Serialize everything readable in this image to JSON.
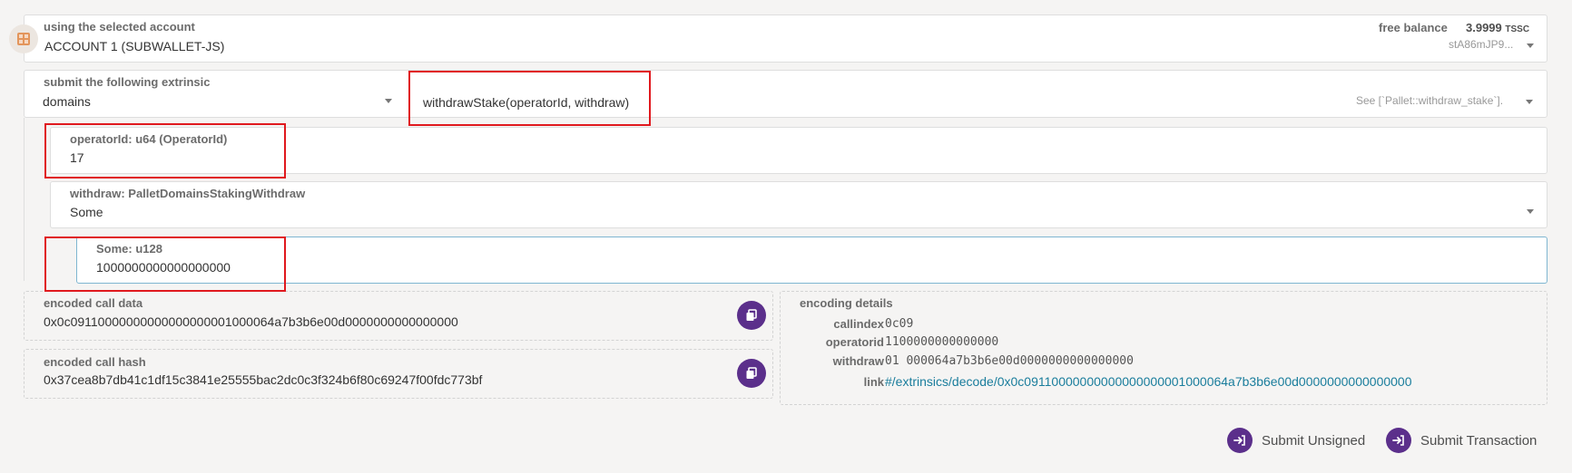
{
  "account": {
    "label": "using the selected account",
    "name": "ACCOUNT 1 (SUBWALLET-JS)",
    "balance_label": "free balance",
    "balance_value": "3.9999",
    "balance_unit": "TSSC",
    "address": "stA86mJP9..."
  },
  "extrinsic": {
    "label": "submit the following extrinsic",
    "pallet": "domains",
    "method": "withdrawStake(operatorId, withdraw)",
    "doc_hint": "See [`Pallet::withdraw_stake`]."
  },
  "params": {
    "operator_label": "operatorId: u64 (OperatorId)",
    "operator_value": "17",
    "withdraw_label": "withdraw: PalletDomainsStakingWithdraw",
    "withdraw_value": "Some",
    "some_label": "Some: u128",
    "some_value": "1000000000000000000"
  },
  "encoded": {
    "call_data_label": "encoded call data",
    "call_data": "0x0c09110000000000000000001000064a7b3b6e00d0000000000000000",
    "call_hash_label": "encoded call hash",
    "call_hash": "0x37cea8b7db41c1df15c3841e25555bac2dc0c3f324b6f80c69247f00fdc773bf"
  },
  "encoding_details": {
    "title": "encoding details",
    "rows": [
      {
        "key": "callindex",
        "value": "0c09"
      },
      {
        "key": "operatorid",
        "value": "1100000000000000"
      },
      {
        "key": "withdraw",
        "value": "01 000064a7b3b6e00d0000000000000000"
      },
      {
        "key": "link",
        "value": "#/extrinsics/decode/0x0c09110000000000000000001000064a7b3b6e00d0000000000000000"
      }
    ]
  },
  "actions": {
    "submit_unsigned": "Submit Unsigned",
    "submit_transaction": "Submit Transaction"
  },
  "colors": {
    "accent": "#5b2f8b",
    "link": "#1a7d9c",
    "highlight": "#e0191e"
  }
}
